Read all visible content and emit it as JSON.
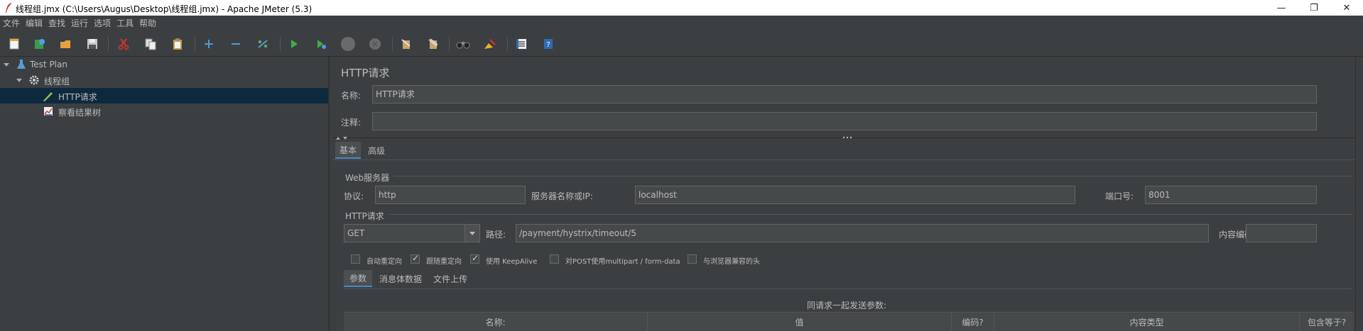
{
  "window": {
    "title": "线程组.jmx (C:\\Users\\Augus\\Desktop\\线程组.jmx) - Apache JMeter (5.3)",
    "minimize": "—",
    "maximize": "❐",
    "close": "✕"
  },
  "menu": [
    "文件",
    "编辑",
    "查找",
    "运行",
    "选项",
    "工具",
    "帮助"
  ],
  "toolbar": [
    "new-icon",
    "templates-icon",
    "open-icon",
    "save-icon",
    "cut-icon",
    "copy-icon",
    "paste-icon",
    "expand-icon",
    "collapse-icon",
    "toggle-icon",
    "start-icon",
    "start-no-pause-icon",
    "stop-icon",
    "shutdown-icon",
    "clear-icon",
    "clear-all-icon",
    "search-icon",
    "reset-search-icon",
    "function-helper-icon",
    "help-icon"
  ],
  "tree": {
    "items": [
      {
        "label": "Test Plan",
        "icon": "test-plan-icon",
        "expanded": true
      },
      {
        "label": "线程组",
        "icon": "thread-group-gear-icon",
        "expanded": true
      },
      {
        "label": "HTTP请求",
        "icon": "http-sampler-pen-icon",
        "selected": true
      },
      {
        "label": "察看结果树",
        "icon": "results-tree-icon"
      }
    ]
  },
  "panel": {
    "title": "HTTP请求",
    "name_label": "名称:",
    "name_value": "HTTP请求",
    "comment_label": "注释:",
    "comment_value": "",
    "tabs": [
      "基本",
      "高级"
    ],
    "web_server": {
      "section": "Web服务器",
      "protocol_label": "协议:",
      "protocol_value": "http",
      "server_label": "服务器名称或IP:",
      "server_value": "localhost",
      "port_label": "端口号:",
      "port_value": "8001"
    },
    "http_request": {
      "section": "HTTP请求",
      "method": "GET",
      "path_label": "路径:",
      "path_value": "/payment/hystrix/timeout/5",
      "encoding_label": "内容编码:",
      "encoding_value": ""
    },
    "options": [
      {
        "label": "自动重定向",
        "checked": false
      },
      {
        "label": "跟随重定向",
        "checked": true
      },
      {
        "label": "使用 KeepAlive",
        "checked": true
      },
      {
        "label": "对POST使用multipart / form-data",
        "checked": false
      },
      {
        "label": "与浏览器兼容的头",
        "checked": false
      }
    ],
    "sub_tabs": [
      "参数",
      "消息体数据",
      "文件上传"
    ],
    "params_caption": "同请求一起发送参数:",
    "table_headers": [
      "名称:",
      "值",
      "编码?",
      "内容类型",
      "包含等于?"
    ]
  }
}
